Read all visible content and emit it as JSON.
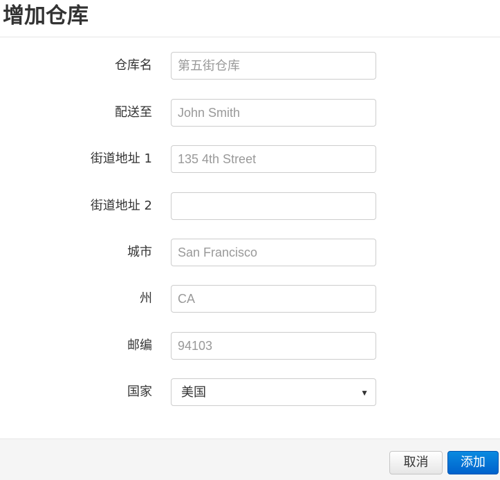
{
  "dialog": {
    "title": "增加仓库"
  },
  "form": {
    "warehouse_name": {
      "label": "仓库名",
      "value": "",
      "placeholder": "第五街仓库"
    },
    "ship_to": {
      "label": "配送至",
      "value": "",
      "placeholder": "John Smith"
    },
    "street1": {
      "label": "街道地址 1",
      "value": "",
      "placeholder": "135 4th Street"
    },
    "street2": {
      "label": "街道地址 2",
      "value": "",
      "placeholder": ""
    },
    "city": {
      "label": "城市",
      "value": "",
      "placeholder": "San Francisco"
    },
    "state": {
      "label": "州",
      "value": "",
      "placeholder": "CA"
    },
    "zip": {
      "label": "邮编",
      "value": "",
      "placeholder": "94103"
    },
    "country": {
      "label": "国家",
      "selected": "美国",
      "arrow_icon": "caret-down-icon"
    }
  },
  "footer": {
    "cancel_label": "取消",
    "add_label": "添加"
  },
  "colors": {
    "primary": "#0a7ddb",
    "border": "#cccccc",
    "footer_bg": "#f5f5f5"
  }
}
